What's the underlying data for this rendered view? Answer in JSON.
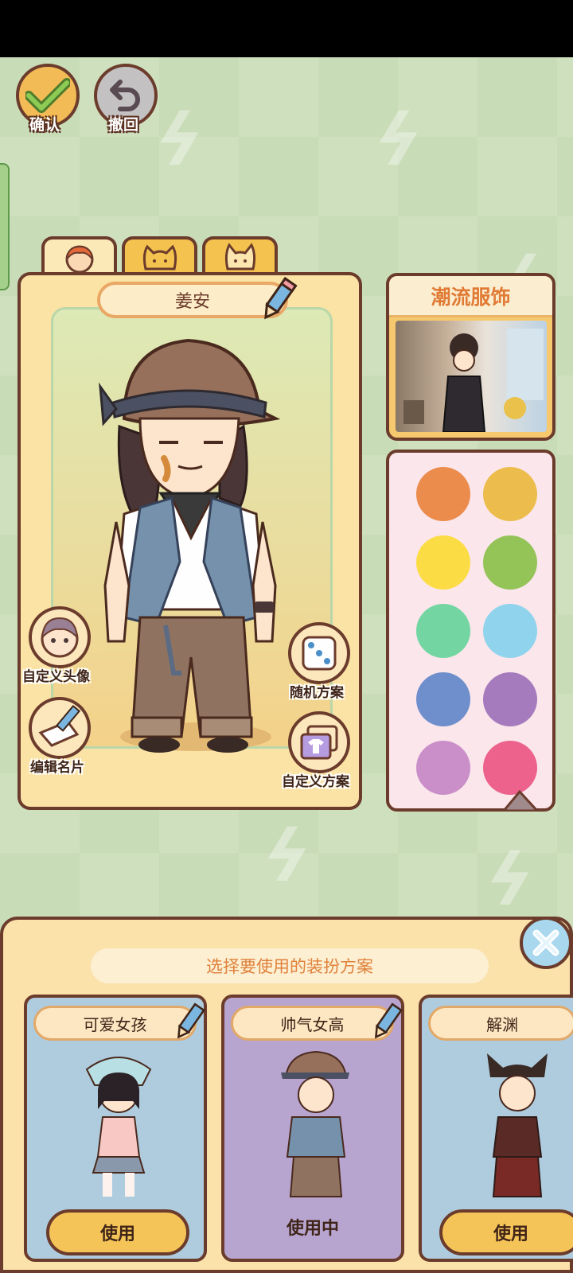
{
  "topbar": {
    "confirm_label": "确认",
    "undo_label": "撤回"
  },
  "tabs": [
    {
      "icon": "girl-face-icon",
      "active": true
    },
    {
      "icon": "cat-face-icon",
      "active": false
    },
    {
      "icon": "cat-face-icon",
      "active": false
    }
  ],
  "character": {
    "name": "姜安",
    "custom_avatar_label": "自定义头像",
    "edit_card_label": "编辑名片",
    "random_plan_label": "随机方案",
    "custom_plan_label": "自定义方案"
  },
  "fashion": {
    "title": "潮流服饰"
  },
  "colors": [
    "#eb8c4c",
    "#ecbd4c",
    "#fcdc45",
    "#94c358",
    "#73d6a2",
    "#8fd4ec",
    "#6f8fcc",
    "#a57bbd",
    "#ca8fc8",
    "#ec628c"
  ],
  "sheet": {
    "title": "选择要使用的装扮方案",
    "plans": [
      {
        "name": "可爱女孩",
        "action": "使用",
        "in_use": false,
        "bg": "#aeccde"
      },
      {
        "name": "帅气女高",
        "action": "使用中",
        "in_use": true,
        "bg": "#b7a4cf"
      },
      {
        "name": "解渊",
        "action": "使用",
        "in_use": false,
        "bg": "#aeccde"
      }
    ]
  }
}
